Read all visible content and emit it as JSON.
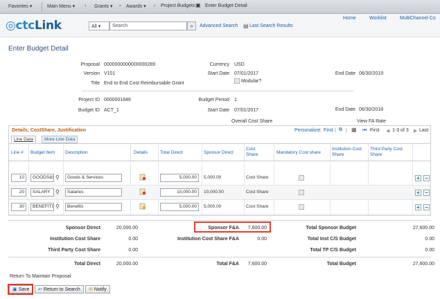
{
  "nav": {
    "favorites": "Favorites ▾",
    "main_menu": "Main Menu ▾",
    "grants": "Grants ▾",
    "awards": "Awards ▾",
    "project_budgets": "Project Budgets",
    "enter_budget": "Enter Budget Detail",
    "sep": "›"
  },
  "header": {
    "logo_prefix": "ctc",
    "logo_suffix": "Link",
    "search_scope": "All",
    "search_placeholder": "Search",
    "advanced_search": "Advanced Search",
    "last_results": "Last Search Results",
    "home": "Home",
    "worklist": "Worklist",
    "multichannel": "MultiChannel Co"
  },
  "page": {
    "title": "Enter Budget Detail"
  },
  "info": {
    "proposal_label": "Proposal",
    "proposal": "0000000000000000289",
    "version_label": "Version",
    "version": "V101",
    "title_label": "Title",
    "title": "End to End Cost Reimbursable Grant",
    "currency_label": "Currency",
    "currency": "USD",
    "start_label": "Start Date",
    "start": "07/01/2017",
    "modular": "Modular?",
    "end_label": "End Date",
    "end": "06/30/2019",
    "project_label": "Project ID",
    "project": "0000001846",
    "budget_label": "Budget ID",
    "budget": "ACT_1",
    "period_label": "Budget Period",
    "period": "1",
    "start2": "07/01/2017",
    "end2": "06/30/2018",
    "overall_cost_share": "Overall Cost Share",
    "view_fa_rate": "View FA Rate"
  },
  "grid": {
    "title": "Details, CostShare, Justification",
    "personalize": "Personalize",
    "find": "Find",
    "nav_first": "First",
    "nav_range": "1-3 of 3",
    "nav_last": "Last",
    "tab1": "Line Data",
    "tab2": "More Line Data",
    "headers": {
      "line": "Line #",
      "budget_item": "Budget Item",
      "description": "Description",
      "details": "Details",
      "total_direct": "Total Direct",
      "sponsor_direct": "Sponsor Direct",
      "cost_share": "Cost Share",
      "mandatory": "Mandatory Cost share",
      "institution": "Institution Cost Share",
      "third_party": "Third Party Cost Share"
    },
    "rows": [
      {
        "line": "10",
        "item": "GOODS&S",
        "desc": "Goods & Services",
        "total": "5,000.00",
        "sponsor": "5,000.00",
        "cs": "Cost Share"
      },
      {
        "line": "20",
        "item": "SALARY",
        "desc": "Salaries",
        "total": "10,000.00",
        "sponsor": "10,000.00",
        "cs": "Cost Share"
      },
      {
        "line": "30",
        "item": "BENEFITS",
        "desc": "Benefits",
        "total": "5,000.00",
        "sponsor": "5,000.00",
        "cs": "Cost Share"
      }
    ]
  },
  "totals": {
    "sponsor_direct_label": "Sponsor Direct",
    "sponsor_direct": "20,000.00",
    "sponsor_fa_label": "Sponsor F&A",
    "sponsor_fa": "7,600.00",
    "total_sponsor_label": "Total Sponsor Budget",
    "total_sponsor": "27,600.00",
    "inst_cs_label": "Institution Cost Share",
    "inst_cs": "0.00",
    "inst_cs_fa_label": "Institution Cost Share F&A",
    "inst_cs_fa": "0.00",
    "total_inst_label": "Total Inst C/S Budget",
    "total_inst": "0.00",
    "third_label": "Third Party Cost Share",
    "third": "0.00",
    "total_tp_label": "Total TP C/S Budget",
    "total_tp": "0.00",
    "total_direct_label": "Total Direct",
    "total_direct": "20,000.00",
    "total_fa_label": "Total F&A",
    "total_fa": "7,600.00",
    "total_budget_label": "Total Budget",
    "total_budget": "27,600.00"
  },
  "footer": {
    "return_link": "Return To Maintain Proposal",
    "save": "Save",
    "return_search": "Return to Search",
    "notify": "Notify"
  }
}
